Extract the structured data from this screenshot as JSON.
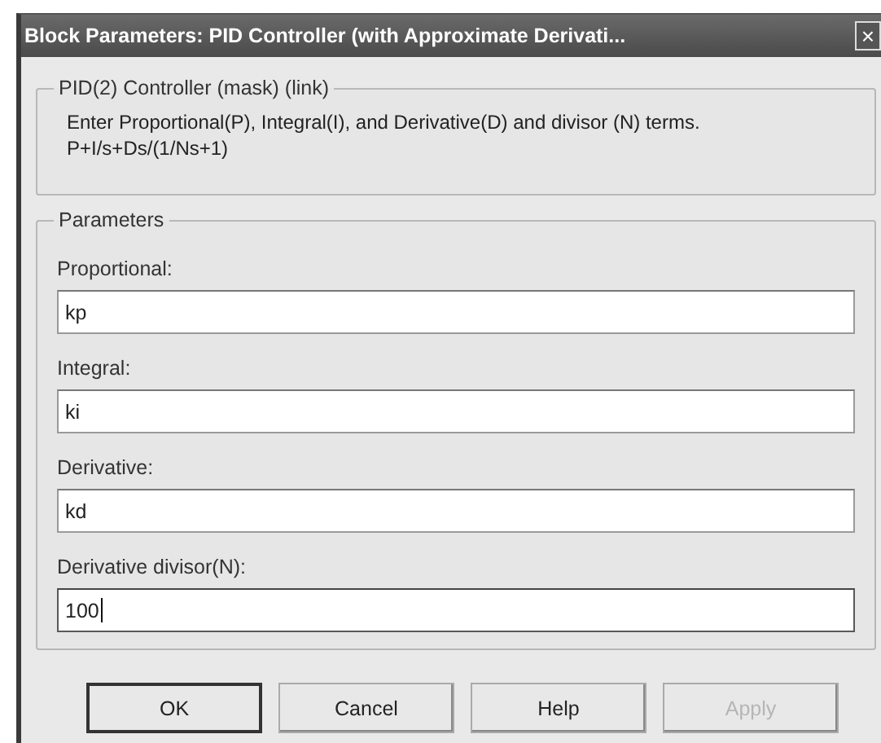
{
  "window": {
    "title": "Block Parameters: PID Controller (with Approximate Derivati...",
    "close": "×"
  },
  "description": {
    "legend": "PID(2) Controller (mask) (link)",
    "lines": [
      "Enter Proportional(P), Integral(I), and Derivative(D) and divisor (N) terms.",
      "P+I/s+Ds/(1/Ns+1)"
    ]
  },
  "parameters": {
    "legend": "Parameters",
    "fields": [
      {
        "label": "Proportional:",
        "value": "kp",
        "focused": false
      },
      {
        "label": "Integral:",
        "value": "ki",
        "focused": false
      },
      {
        "label": "Derivative:",
        "value": "kd",
        "focused": false
      },
      {
        "label": "Derivative divisor(N):",
        "value": "100",
        "focused": true
      }
    ]
  },
  "buttons": [
    {
      "label": "OK",
      "default": true,
      "disabled": false
    },
    {
      "label": "Cancel",
      "default": false,
      "disabled": false
    },
    {
      "label": "Help",
      "default": false,
      "disabled": false
    },
    {
      "label": "Apply",
      "default": false,
      "disabled": true
    }
  ]
}
